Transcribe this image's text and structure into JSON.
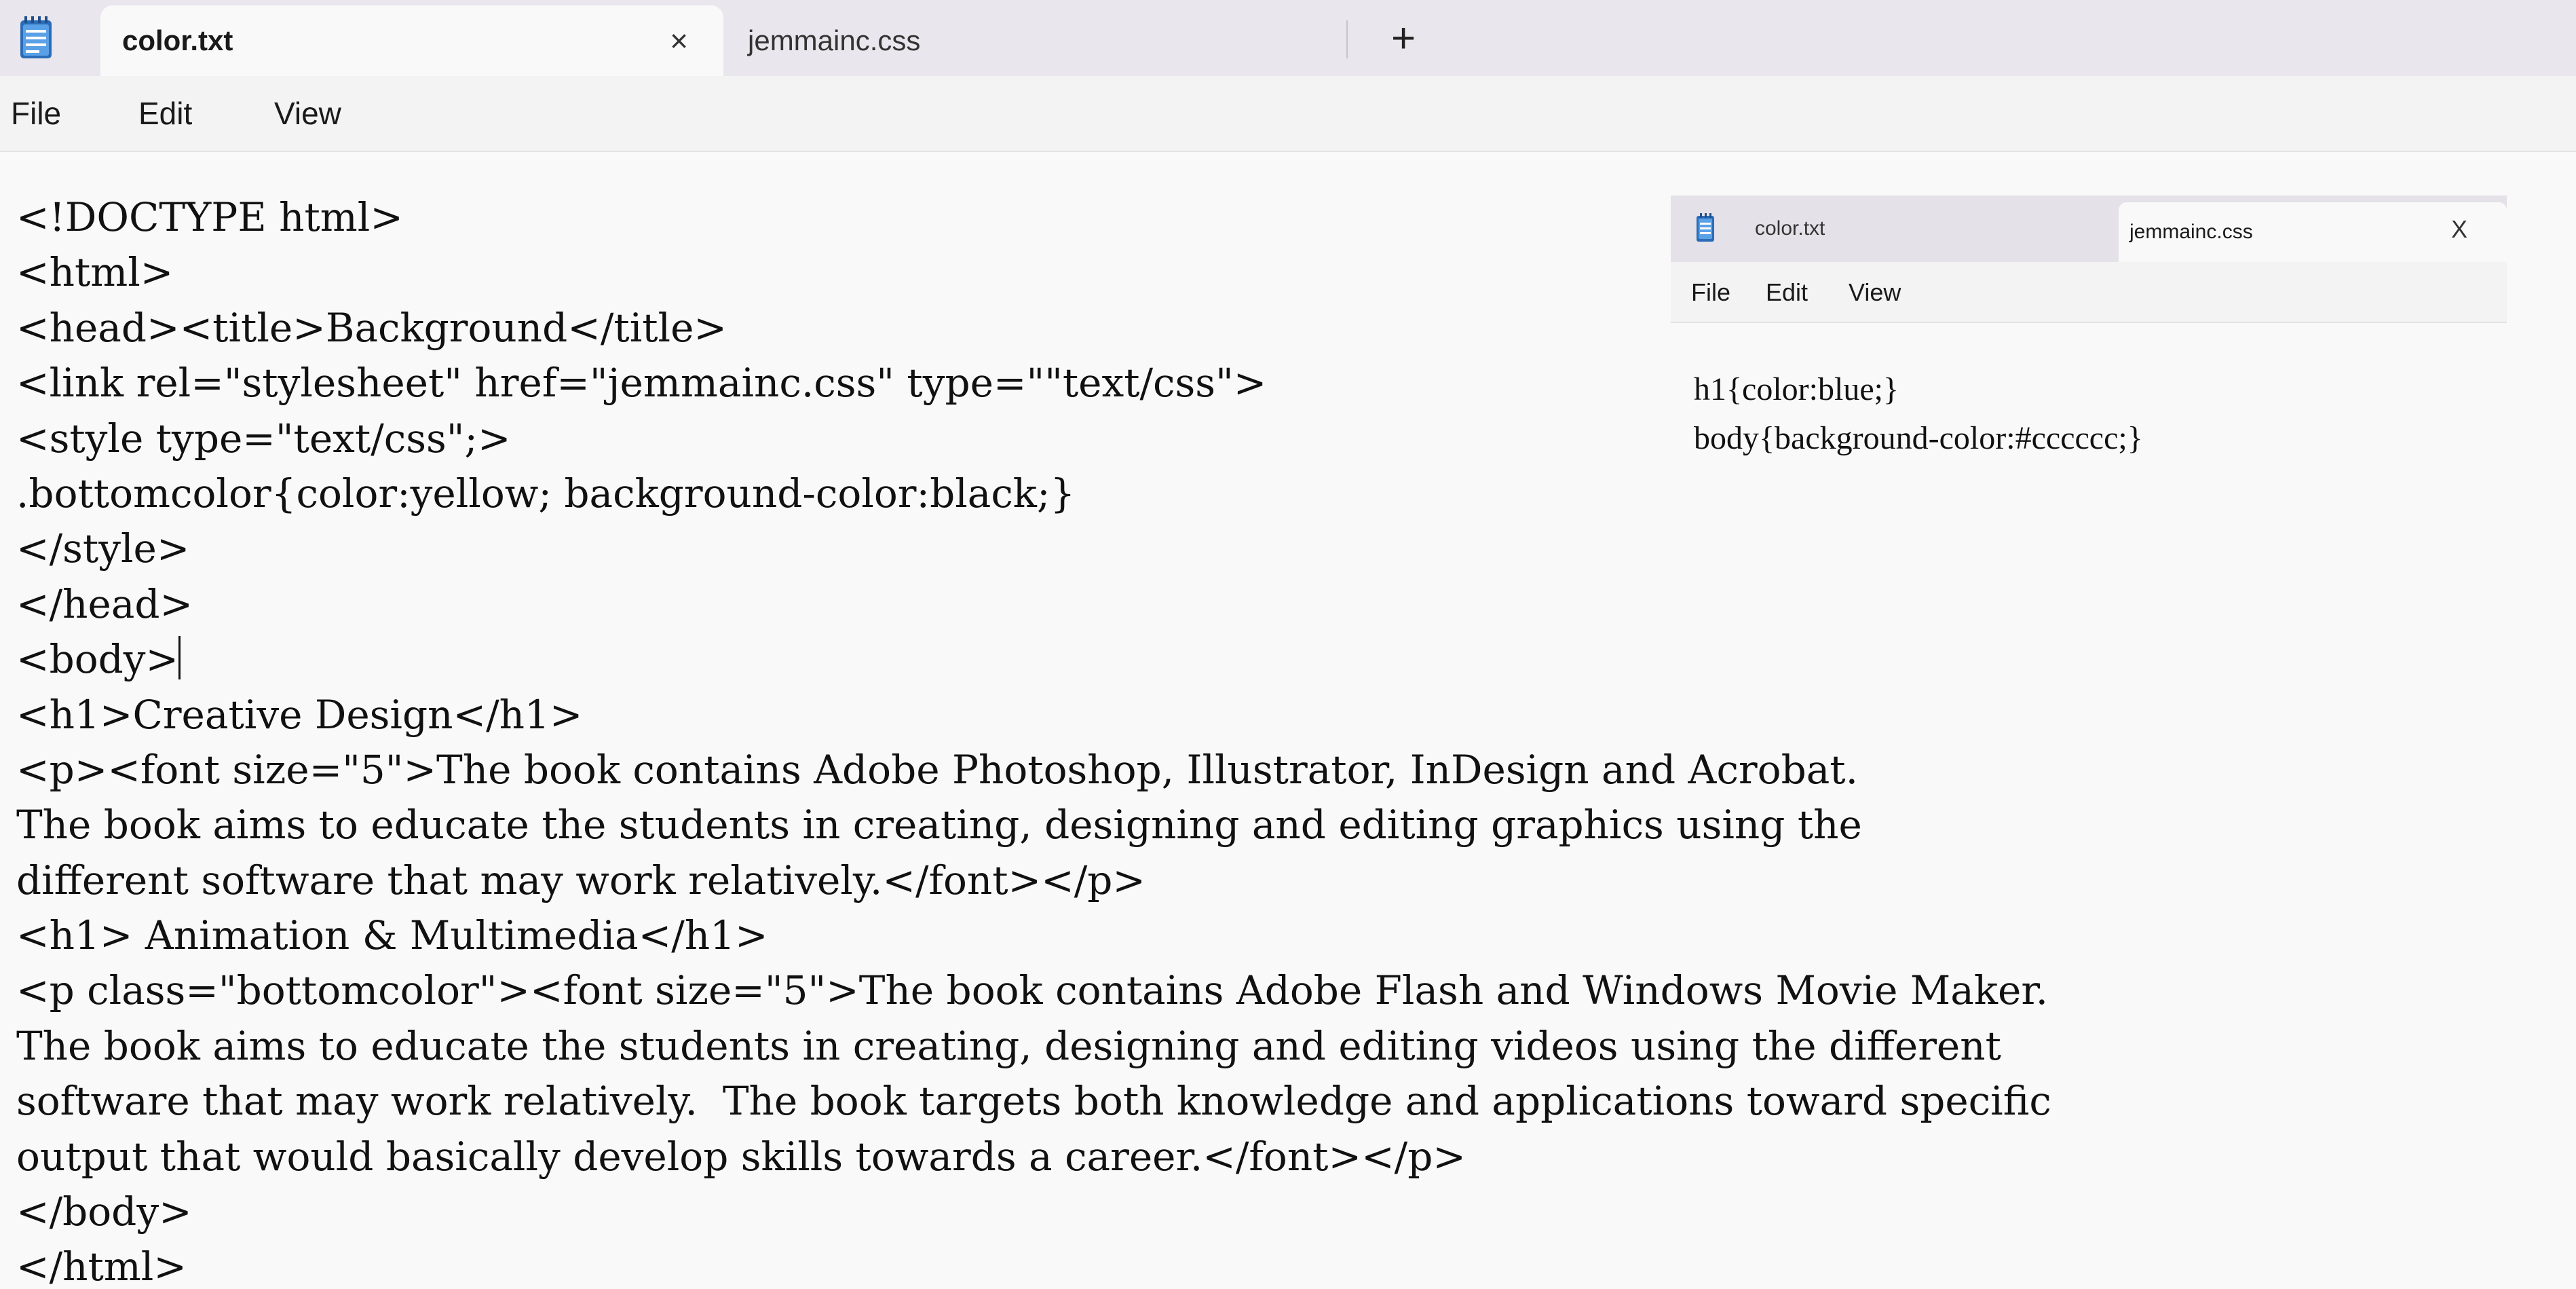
{
  "tabs": {
    "active": {
      "label": "color.txt",
      "close_glyph": "×"
    },
    "inactive": {
      "label": "jemmainc.css"
    },
    "add_glyph": "+"
  },
  "menu": {
    "file": "File",
    "edit": "Edit",
    "view": "View"
  },
  "editor_lines": [
    "<!DOCTYPE html>",
    "<html>",
    "<head><title>Background</title>",
    "<link rel=\"stylesheet\" href=\"jemmainc.css\" type=\"\"text/css\">",
    "<style type=\"text/css\";>",
    ".bottomcolor{color:yellow; background-color:black;}",
    "</style>",
    "</head>",
    "<body>",
    "<h1>Creative Design</h1>",
    "<p><font size=\"5\">The book contains Adobe Photoshop, Illustrator, InDesign and Acrobat.",
    "The book aims to educate the students in creating, designing and editing graphics using the",
    "different software that may work relatively.</font></p>",
    "<h1> Animation & Multimedia</h1>",
    "<p class=\"bottomcolor\"><font size=\"5\">The book contains Adobe Flash and Windows Movie Maker.",
    "The book aims to educate the students in creating, designing and editing videos using the different",
    "software that may work relatively.  The book targets both knowledge and applications toward specific",
    "output that would basically develop skills towards a career.</font></p>",
    "</body>",
    "</html>"
  ],
  "mini_window": {
    "tabs": {
      "inactive_label": "color.txt",
      "active_label": "jemmainc.css",
      "close_glyph": "X"
    },
    "menu": {
      "file": "File",
      "edit": "Edit",
      "view": "View"
    },
    "lines": [
      "h1{color:blue;}",
      "body{background-color:#cccccc;}"
    ]
  },
  "colors": {
    "tabbar_bg": "#e9e7ed",
    "editor_bg": "#f9f9f9",
    "notepad_icon": "#1f5fa8"
  },
  "icons": {
    "app": "notepad-icon",
    "close": "close-icon",
    "add": "plus-icon"
  }
}
